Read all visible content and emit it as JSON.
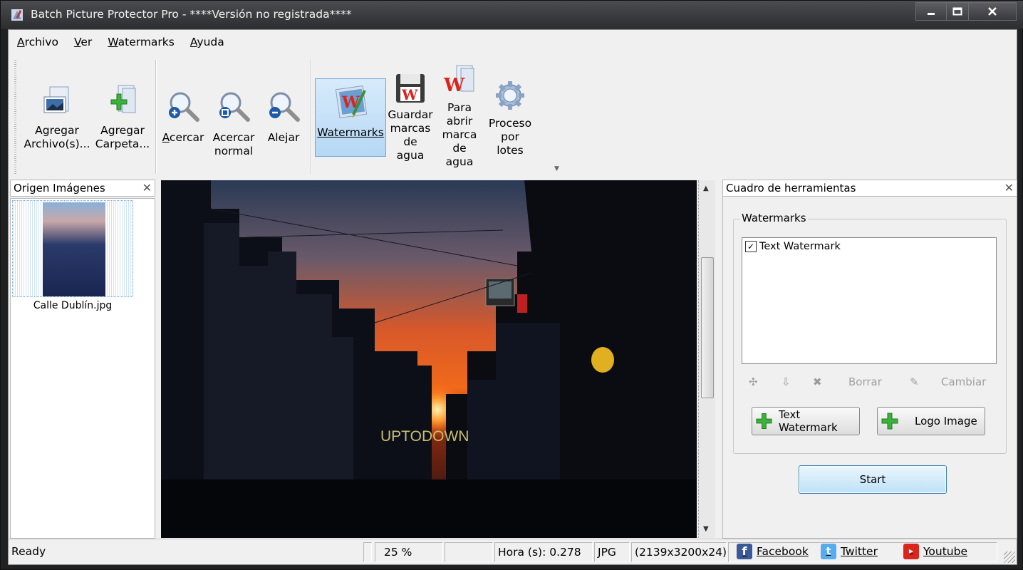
{
  "window": {
    "title": "Batch Picture Protector Pro - ****Versión no registrada****"
  },
  "menu": [
    "Archivo",
    "Ver",
    "Watermarks",
    "Ayuda"
  ],
  "ribbon": {
    "add_files": "Agregar\nArchivo(s)...",
    "add_folder": "Agregar\nCarpeta...",
    "zoom_in": "Acercar",
    "zoom_normal": "Acercar\nnormal",
    "zoom_out": "Alejar",
    "watermarks": "Watermarks",
    "save_watermarks": "Guardar\nmarcas\nde\nagua",
    "open_watermark": "Para\nabrir\nmarca\nde\nagua",
    "batch": "Proceso\npor\nlotes"
  },
  "left_panel": {
    "title": "Origen Imágenes",
    "files": [
      {
        "name": "Calle Dublín.jpg"
      }
    ]
  },
  "preview": {
    "watermark_text": "UPTODOWN"
  },
  "toolbox": {
    "title": "Cuadro de herramientas",
    "group_title": "Watermarks",
    "items": [
      {
        "label": "Text Watermark",
        "checked": true
      }
    ],
    "delete_label": "Borrar",
    "change_label": "Cambiar",
    "add_text_label": "Text Watermark",
    "add_logo_label": "Logo Image",
    "start_label": "Start"
  },
  "status": {
    "ready": "Ready",
    "zoom": "25 %",
    "time": "Hora (s): 0.278",
    "format": "JPG",
    "dimensions": "(2139x3200x24)",
    "facebook": "Facebook",
    "twitter": "Twitter",
    "youtube": "Youtube"
  },
  "colors": {
    "active_button": "#b6d8f5",
    "facebook": "#3b5998",
    "twitter": "#55acee",
    "youtube": "#d9261c"
  }
}
